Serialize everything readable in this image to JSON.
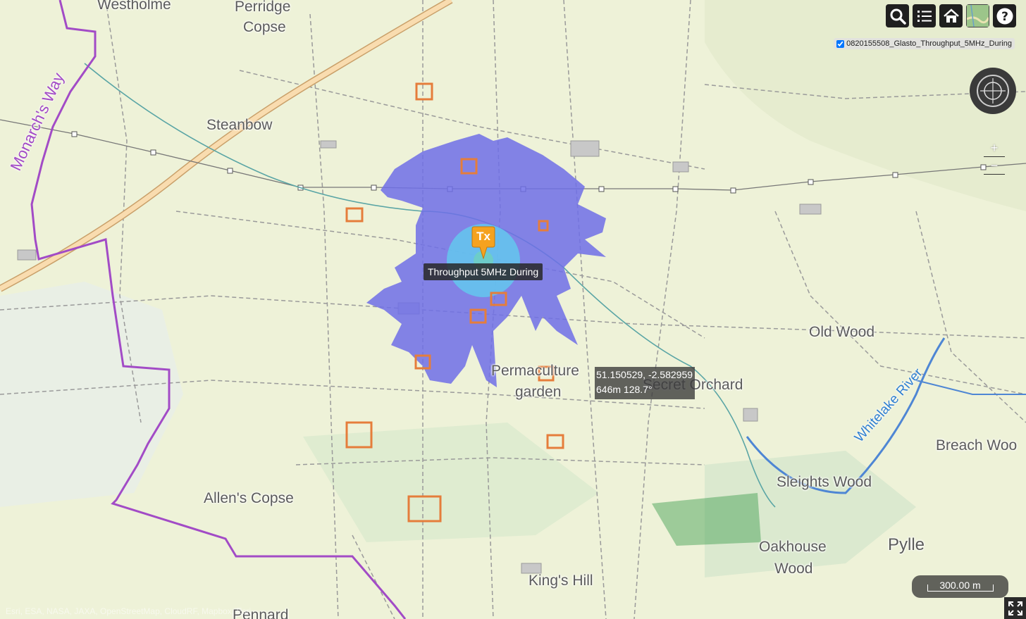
{
  "map": {
    "place_labels": {
      "westholme": "Westholme",
      "perridge_1": "Perridge",
      "perridge_2": "Copse",
      "steanbow": "Steanbow",
      "old_wood": "Old Wood",
      "permaculture_1": "Permaculture",
      "permaculture_2": "garden",
      "secret_orchard": "Secret Orchard",
      "breach_wood": "Breach Woo",
      "sleights_wood": "Sleights Wood",
      "allens_copse": "Allen's Copse",
      "oakhouse_1": "Oakhouse",
      "oakhouse_2": "Wood",
      "pylle": "Pylle",
      "kings_hill": "King's Hill",
      "pennard": "Pennard"
    },
    "monarchs_way": "Monarch's Way",
    "whitelake_river": "Whitelake River",
    "colors": {
      "coverage_outer": "#6f6fe8",
      "coverage_inner": "#64c8ee",
      "marker": "#f5a21f",
      "receiver_box": "#e57d3b",
      "footpath_purple": "#a24bc6",
      "road": "#f7d9a8"
    }
  },
  "toolbar": {
    "search": "search-icon",
    "layers": "list-icon",
    "home": "home-icon",
    "basemap": "basemap-thumbnail",
    "help": "help-icon"
  },
  "layer_list": {
    "checked": true,
    "label": "0820155508_Glasto_Throughput_5MHz_During"
  },
  "zoom": {
    "in": "+",
    "out": "−"
  },
  "marker": {
    "label": "Tx",
    "tooltip": "Throughput 5MHz During"
  },
  "coordinate_readout": {
    "latlon": "51.150529, -2.582959",
    "distance_bearing": "646m 128.7°"
  },
  "scale": "300.00 m",
  "attribution": "Esri, ESA, NASA, JAXA, OpenStreetMap, CloudRF, Mapbox, Esri"
}
